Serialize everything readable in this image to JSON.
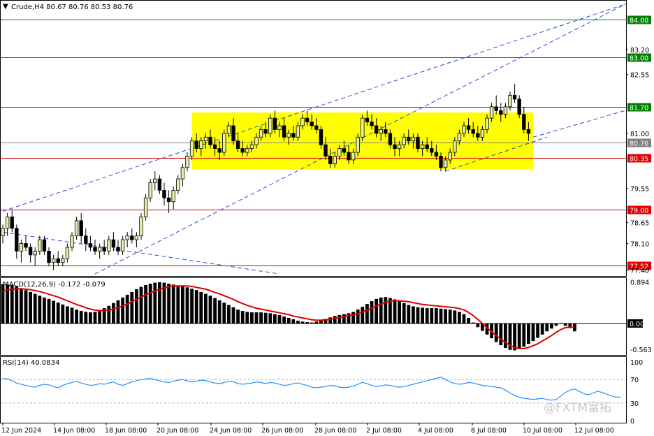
{
  "chart_data": {
    "type": "candlestick",
    "symbol_line": "Crude,H4  80.67 80.76 80.53 80.76",
    "price_ticks": [
      "84.00",
      "83.20",
      "83.00",
      "82.55",
      "81.70",
      "81.00",
      "80.76",
      "80.35",
      "79.55",
      "79.00",
      "78.65",
      "78.10",
      "77.52",
      "77.40"
    ],
    "price_range": [
      77.3,
      84.4
    ],
    "horizontal_levels": [
      {
        "price": 84.0,
        "label": "84.00",
        "color": "#008000"
      },
      {
        "price": 83.0,
        "label": "83.00",
        "color": "#008000"
      },
      {
        "price": 81.7,
        "label": "81.70",
        "color": "#008000"
      },
      {
        "price": 80.76,
        "label": "80.76",
        "color": "#808080"
      },
      {
        "price": 80.35,
        "label": "80.35",
        "color": "#e00000"
      },
      {
        "price": 79.0,
        "label": "79.00",
        "color": "#e00000"
      },
      {
        "price": 77.52,
        "label": "77.52",
        "color": "#e00000"
      }
    ],
    "consolidation_box": {
      "bar_start": 41,
      "bar_end": 115,
      "price_top": 81.55,
      "price_bottom": 80.05,
      "color": "#ffff00"
    },
    "trendlines": [
      {
        "b1": 0,
        "p1": 78.95,
        "b2": 135,
        "p2": 84.4
      },
      {
        "b1": 20,
        "p1": 77.3,
        "b2": 135,
        "p2": 84.4
      },
      {
        "b1": 0,
        "p1": 78.4,
        "b2": 60,
        "p2": 77.3
      },
      {
        "b1": 96,
        "p1": 80.0,
        "b2": 118,
        "p2": 80.9
      },
      {
        "b1": 115,
        "p1": 80.9,
        "b2": 215,
        "p2": 84.4
      }
    ],
    "candles": [
      [
        78.3,
        78.6,
        78.1,
        78.5
      ],
      [
        78.5,
        78.9,
        78.3,
        78.8
      ],
      [
        78.8,
        79.0,
        78.4,
        78.5
      ],
      [
        78.5,
        78.6,
        77.7,
        77.9
      ],
      [
        77.9,
        78.2,
        77.6,
        78.1
      ],
      [
        78.1,
        78.3,
        77.9,
        78.0
      ],
      [
        78.0,
        78.1,
        77.6,
        77.8
      ],
      [
        77.8,
        78.0,
        77.5,
        77.9
      ],
      [
        77.9,
        78.3,
        77.8,
        78.2
      ],
      [
        78.2,
        78.3,
        77.8,
        77.9
      ],
      [
        77.9,
        78.0,
        77.5,
        77.6
      ],
      [
        77.6,
        77.8,
        77.4,
        77.7
      ],
      [
        77.7,
        77.9,
        77.5,
        77.6
      ],
      [
        77.6,
        77.8,
        77.5,
        77.7
      ],
      [
        77.7,
        78.1,
        77.6,
        78.0
      ],
      [
        78.0,
        78.4,
        77.9,
        78.3
      ],
      [
        78.3,
        78.8,
        78.2,
        78.7
      ],
      [
        78.7,
        78.9,
        78.1,
        78.3
      ],
      [
        78.3,
        78.5,
        77.9,
        78.1
      ],
      [
        78.1,
        78.3,
        77.9,
        78.0
      ],
      [
        78.0,
        78.2,
        77.8,
        77.9
      ],
      [
        77.9,
        78.1,
        77.7,
        78.0
      ],
      [
        78.0,
        78.2,
        77.8,
        77.9
      ],
      [
        77.9,
        78.3,
        77.8,
        78.2
      ],
      [
        78.2,
        78.4,
        77.9,
        78.0
      ],
      [
        78.0,
        78.2,
        77.8,
        77.9
      ],
      [
        77.9,
        78.3,
        77.8,
        78.2
      ],
      [
        78.2,
        78.4,
        78.0,
        78.3
      ],
      [
        78.3,
        78.5,
        78.1,
        78.2
      ],
      [
        78.2,
        78.4,
        78.0,
        78.3
      ],
      [
        78.3,
        78.9,
        78.2,
        78.8
      ],
      [
        78.8,
        79.4,
        78.7,
        79.3
      ],
      [
        79.3,
        79.8,
        79.2,
        79.7
      ],
      [
        79.7,
        80.0,
        79.5,
        79.8
      ],
      [
        79.8,
        79.9,
        79.4,
        79.5
      ],
      [
        79.5,
        79.7,
        79.1,
        79.3
      ],
      [
        79.3,
        79.5,
        78.9,
        79.2
      ],
      [
        79.2,
        79.6,
        79.0,
        79.5
      ],
      [
        79.5,
        79.9,
        79.4,
        79.8
      ],
      [
        79.8,
        80.2,
        79.6,
        80.1
      ],
      [
        80.1,
        80.5,
        80.0,
        80.4
      ],
      [
        80.4,
        80.9,
        80.3,
        80.8
      ],
      [
        80.8,
        81.0,
        80.5,
        80.6
      ],
      [
        80.6,
        80.9,
        80.4,
        80.8
      ],
      [
        80.8,
        81.0,
        80.6,
        80.9
      ],
      [
        80.9,
        81.1,
        80.6,
        80.7
      ],
      [
        80.7,
        80.9,
        80.4,
        80.6
      ],
      [
        80.6,
        80.8,
        80.3,
        80.5
      ],
      [
        80.5,
        81.1,
        80.4,
        81.0
      ],
      [
        81.0,
        81.3,
        80.9,
        81.2
      ],
      [
        81.2,
        81.4,
        80.7,
        80.8
      ],
      [
        80.8,
        81.0,
        80.5,
        80.6
      ],
      [
        80.6,
        80.8,
        80.4,
        80.5
      ],
      [
        80.5,
        80.7,
        80.4,
        80.6
      ],
      [
        80.6,
        80.8,
        80.5,
        80.7
      ],
      [
        80.7,
        81.0,
        80.6,
        80.9
      ],
      [
        80.9,
        81.2,
        80.8,
        81.1
      ],
      [
        81.1,
        81.3,
        80.9,
        81.0
      ],
      [
        81.0,
        81.5,
        80.9,
        81.4
      ],
      [
        81.4,
        81.6,
        81.0,
        81.1
      ],
      [
        81.1,
        81.3,
        80.9,
        81.2
      ],
      [
        81.2,
        81.4,
        80.8,
        80.9
      ],
      [
        80.9,
        81.1,
        80.7,
        81.0
      ],
      [
        81.0,
        81.2,
        80.8,
        80.9
      ],
      [
        80.9,
        81.3,
        80.8,
        81.2
      ],
      [
        81.2,
        81.5,
        81.1,
        81.4
      ],
      [
        81.4,
        81.6,
        81.2,
        81.3
      ],
      [
        81.3,
        81.5,
        81.1,
        81.2
      ],
      [
        81.2,
        81.4,
        81.0,
        81.1
      ],
      [
        81.1,
        81.2,
        80.6,
        80.7
      ],
      [
        80.7,
        80.9,
        80.3,
        80.4
      ],
      [
        80.4,
        80.6,
        80.1,
        80.2
      ],
      [
        80.2,
        80.5,
        80.1,
        80.4
      ],
      [
        80.4,
        80.7,
        80.3,
        80.6
      ],
      [
        80.6,
        80.8,
        80.4,
        80.5
      ],
      [
        80.5,
        80.7,
        80.2,
        80.3
      ],
      [
        80.3,
        80.6,
        80.2,
        80.5
      ],
      [
        80.5,
        81.0,
        80.4,
        80.9
      ],
      [
        80.9,
        81.5,
        80.8,
        81.4
      ],
      [
        81.4,
        81.6,
        81.2,
        81.3
      ],
      [
        81.3,
        81.5,
        81.1,
        81.2
      ],
      [
        81.2,
        81.4,
        80.9,
        81.0
      ],
      [
        81.0,
        81.2,
        80.8,
        81.1
      ],
      [
        81.1,
        81.3,
        80.9,
        81.0
      ],
      [
        81.0,
        81.1,
        80.6,
        80.7
      ],
      [
        80.7,
        80.9,
        80.4,
        80.6
      ],
      [
        80.6,
        80.8,
        80.4,
        80.7
      ],
      [
        80.7,
        81.0,
        80.6,
        80.9
      ],
      [
        80.9,
        81.1,
        80.7,
        80.8
      ],
      [
        80.8,
        81.0,
        80.6,
        80.9
      ],
      [
        80.9,
        81.0,
        80.5,
        80.6
      ],
      [
        80.6,
        80.8,
        80.4,
        80.7
      ],
      [
        80.7,
        80.9,
        80.5,
        80.6
      ],
      [
        80.6,
        80.8,
        80.4,
        80.5
      ],
      [
        80.5,
        80.7,
        80.3,
        80.4
      ],
      [
        80.4,
        80.5,
        80.0,
        80.1
      ],
      [
        80.1,
        80.4,
        80.0,
        80.3
      ],
      [
        80.3,
        80.6,
        80.2,
        80.5
      ],
      [
        80.5,
        80.9,
        80.4,
        80.8
      ],
      [
        80.8,
        81.1,
        80.7,
        81.0
      ],
      [
        81.0,
        81.3,
        80.9,
        81.2
      ],
      [
        81.2,
        81.4,
        81.0,
        81.1
      ],
      [
        81.1,
        81.3,
        80.9,
        81.0
      ],
      [
        81.0,
        81.2,
        80.8,
        80.9
      ],
      [
        80.9,
        81.2,
        80.8,
        81.1
      ],
      [
        81.1,
        81.5,
        81.0,
        81.4
      ],
      [
        81.4,
        81.8,
        81.3,
        81.7
      ],
      [
        81.7,
        82.0,
        81.5,
        81.6
      ],
      [
        81.6,
        81.8,
        81.3,
        81.5
      ],
      [
        81.5,
        81.8,
        81.4,
        81.7
      ],
      [
        81.7,
        82.1,
        81.6,
        82.0
      ],
      [
        82.0,
        82.3,
        81.8,
        81.9
      ],
      [
        81.9,
        82.0,
        81.4,
        81.5
      ],
      [
        81.5,
        81.7,
        81.0,
        81.1
      ],
      [
        81.1,
        81.3,
        80.8,
        81.0
      ]
    ],
    "macd_label": "MACD(12,26,9) -0.172 -0.079",
    "macd_ticks": [
      "0.894",
      "0.00",
      "-0.563"
    ],
    "macd_range": [
      -0.65,
      0.95
    ],
    "macd_hist": [
      0.85,
      0.84,
      0.83,
      0.8,
      0.76,
      0.72,
      0.68,
      0.64,
      0.6,
      0.56,
      0.53,
      0.49,
      0.45,
      0.41,
      0.37,
      0.34,
      0.3,
      0.27,
      0.25,
      0.24,
      0.25,
      0.28,
      0.33,
      0.38,
      0.44,
      0.5,
      0.56,
      0.62,
      0.68,
      0.74,
      0.79,
      0.83,
      0.86,
      0.88,
      0.89,
      0.88,
      0.86,
      0.84,
      0.82,
      0.8,
      0.78,
      0.75,
      0.72,
      0.68,
      0.64,
      0.6,
      0.55,
      0.5,
      0.45,
      0.4,
      0.35,
      0.3,
      0.27,
      0.25,
      0.24,
      0.24,
      0.24,
      0.23,
      0.22,
      0.2,
      0.18,
      0.15,
      0.12,
      0.09,
      0.06,
      0.04,
      0.03,
      0.02,
      0.04,
      0.07,
      0.1,
      0.13,
      0.16,
      0.18,
      0.2,
      0.22,
      0.25,
      0.3,
      0.36,
      0.42,
      0.48,
      0.53,
      0.56,
      0.57,
      0.55,
      0.52,
      0.48,
      0.44,
      0.4,
      0.37,
      0.35,
      0.34,
      0.33,
      0.33,
      0.33,
      0.32,
      0.31,
      0.3,
      0.28,
      0.25,
      0.2,
      0.12,
      0.02,
      -0.08,
      -0.16,
      -0.24,
      -0.32,
      -0.4,
      -0.47,
      -0.53,
      -0.57,
      -0.58,
      -0.55,
      -0.5,
      -0.44,
      -0.38,
      -0.31,
      -0.24,
      -0.17,
      -0.11,
      -0.05,
      -0.01,
      -0.05,
      -0.1,
      -0.17
    ],
    "macd_signal": [
      0.7,
      0.72,
      0.74,
      0.75,
      0.75,
      0.74,
      0.73,
      0.71,
      0.69,
      0.66,
      0.63,
      0.6,
      0.57,
      0.53,
      0.49,
      0.45,
      0.41,
      0.38,
      0.34,
      0.31,
      0.29,
      0.28,
      0.28,
      0.29,
      0.31,
      0.34,
      0.38,
      0.42,
      0.47,
      0.52,
      0.57,
      0.62,
      0.66,
      0.7,
      0.74,
      0.77,
      0.79,
      0.81,
      0.81,
      0.81,
      0.81,
      0.8,
      0.78,
      0.76,
      0.74,
      0.71,
      0.67,
      0.64,
      0.6,
      0.56,
      0.52,
      0.47,
      0.43,
      0.39,
      0.36,
      0.33,
      0.31,
      0.29,
      0.27,
      0.25,
      0.23,
      0.21,
      0.19,
      0.16,
      0.14,
      0.12,
      0.1,
      0.08,
      0.07,
      0.07,
      0.08,
      0.09,
      0.11,
      0.13,
      0.15,
      0.17,
      0.19,
      0.21,
      0.25,
      0.29,
      0.33,
      0.38,
      0.42,
      0.46,
      0.48,
      0.49,
      0.49,
      0.48,
      0.47,
      0.45,
      0.43,
      0.41,
      0.4,
      0.39,
      0.38,
      0.37,
      0.36,
      0.35,
      0.34,
      0.32,
      0.29,
      0.24,
      0.17,
      0.09,
      0.0,
      -0.09,
      -0.18,
      -0.26,
      -0.34,
      -0.41,
      -0.47,
      -0.52,
      -0.54,
      -0.54,
      -0.52,
      -0.48,
      -0.44,
      -0.38,
      -0.32,
      -0.26,
      -0.19,
      -0.13,
      -0.09,
      -0.08,
      -0.08
    ],
    "rsi_label": "RSI(14) 40.0834",
    "rsi_ticks": [
      "100",
      "70",
      "30",
      "0"
    ],
    "rsi_levels": [
      70,
      30
    ],
    "rsi_values": [
      72,
      71,
      68,
      64,
      62,
      60,
      58,
      57,
      60,
      62,
      61,
      58,
      56,
      60,
      63,
      65,
      67,
      64,
      62,
      60,
      61,
      63,
      62,
      64,
      66,
      62,
      60,
      63,
      66,
      68,
      70,
      71,
      72,
      70,
      68,
      66,
      65,
      67,
      69,
      70,
      68,
      66,
      67,
      69,
      68,
      66,
      64,
      63,
      65,
      67,
      66,
      63,
      62,
      63,
      64,
      66,
      65,
      63,
      65,
      64,
      62,
      60,
      61,
      63,
      64,
      62,
      60,
      57,
      56,
      57,
      58,
      60,
      59,
      57,
      56,
      57,
      59,
      62,
      65,
      63,
      60,
      58,
      59,
      61,
      60,
      58,
      57,
      58,
      60,
      62,
      64,
      66,
      68,
      70,
      72,
      74,
      70,
      66,
      63,
      62,
      63,
      65,
      64,
      62,
      60,
      59,
      58,
      57,
      56,
      52,
      47,
      43,
      40,
      38,
      37,
      36,
      37,
      38,
      36,
      35,
      36,
      42,
      48,
      52,
      54,
      50,
      46,
      44,
      47,
      50,
      48,
      45,
      42,
      40,
      40
    ],
    "x_ticks": [
      "12 Jun 2024",
      "14 Jun 08:00",
      "18 Jun 08:00",
      "20 Jun 08:00",
      "24 Jun 08:00",
      "26 Jun 08:00",
      "28 Jun 08:00",
      "2 Jul 08:00",
      "4 Jul 08:00",
      "8 Jul 08:00",
      "10 Jul 08:00",
      "12 Jul 08:00"
    ],
    "watermark": "@FXTM富拓"
  }
}
